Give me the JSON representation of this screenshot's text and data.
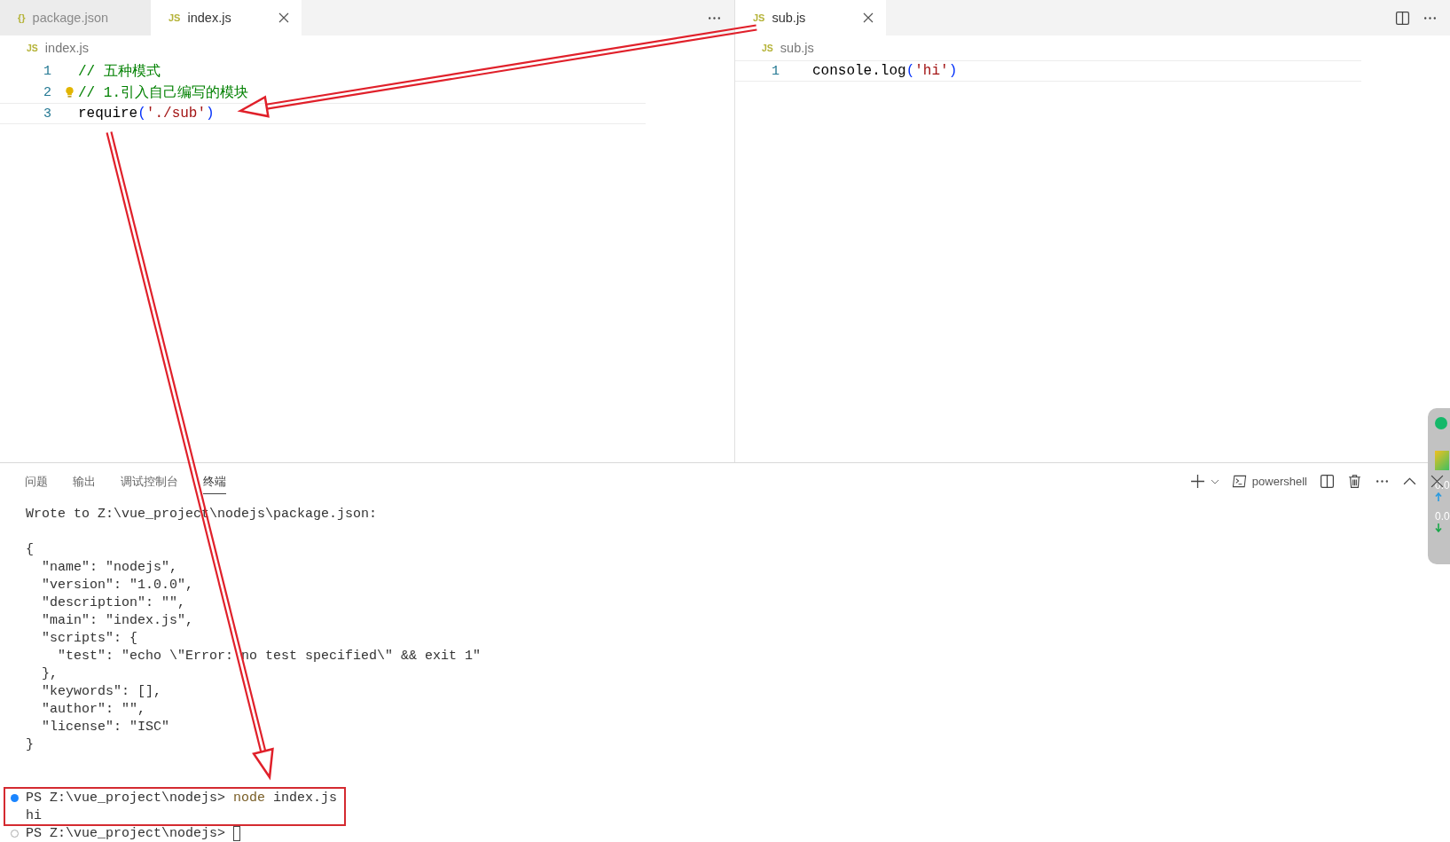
{
  "editor_groups": [
    {
      "tabs": [
        {
          "badge": "{}",
          "label": "package.json",
          "selected": false,
          "closable": false
        },
        {
          "badge": "JS",
          "label": "index.js",
          "selected": true,
          "closable": true
        }
      ],
      "breadcrumb": {
        "badge": "JS",
        "label": "index.js"
      },
      "lines": [
        {
          "number": "1",
          "current": false,
          "lightbulb": false,
          "tokens": [
            {
              "kind": "comment",
              "text": "// 五种模式"
            }
          ]
        },
        {
          "number": "2",
          "current": false,
          "lightbulb": true,
          "tokens": [
            {
              "kind": "comment",
              "text": "// 1.引入自己编写的模块"
            }
          ]
        },
        {
          "number": "3",
          "current": true,
          "lightbulb": false,
          "tokens": [
            {
              "kind": "plain",
              "text": "require"
            },
            {
              "kind": "bracket",
              "text": "("
            },
            {
              "kind": "string",
              "text": "'./sub'"
            },
            {
              "kind": "bracket",
              "text": ")"
            }
          ]
        }
      ]
    },
    {
      "tabs": [
        {
          "badge": "JS",
          "label": "sub.js",
          "selected": true,
          "closable": true
        }
      ],
      "breadcrumb": {
        "badge": "JS",
        "label": "sub.js"
      },
      "lines": [
        {
          "number": "1",
          "current": true,
          "lightbulb": false,
          "tokens": [
            {
              "kind": "plain",
              "text": "console.log"
            },
            {
              "kind": "bracket",
              "text": "("
            },
            {
              "kind": "string",
              "text": "'hi'"
            },
            {
              "kind": "bracket",
              "text": ")"
            }
          ]
        }
      ]
    }
  ],
  "panel": {
    "tabs": [
      {
        "label": "问题",
        "selected": false
      },
      {
        "label": "输出",
        "selected": false
      },
      {
        "label": "调试控制台",
        "selected": false
      },
      {
        "label": "终端",
        "selected": true
      }
    ],
    "terminal_name": "powershell",
    "lines": [
      {
        "kind": "text",
        "text": "Wrote to Z:\\vue_project\\nodejs\\package.json:"
      },
      {
        "kind": "blank"
      },
      {
        "kind": "text",
        "text": "{"
      },
      {
        "kind": "text",
        "text": "  \"name\": \"nodejs\","
      },
      {
        "kind": "text",
        "text": "  \"version\": \"1.0.0\","
      },
      {
        "kind": "text",
        "text": "  \"description\": \"\","
      },
      {
        "kind": "text",
        "text": "  \"main\": \"index.js\","
      },
      {
        "kind": "text",
        "text": "  \"scripts\": {"
      },
      {
        "kind": "text",
        "text": "    \"test\": \"echo \\\"Error: no test specified\\\" && exit 1\""
      },
      {
        "kind": "text",
        "text": "  },"
      },
      {
        "kind": "text",
        "text": "  \"keywords\": [],"
      },
      {
        "kind": "text",
        "text": "  \"author\": \"\","
      },
      {
        "kind": "text",
        "text": "  \"license\": \"ISC\""
      },
      {
        "kind": "text",
        "text": "}"
      },
      {
        "kind": "blank"
      },
      {
        "kind": "blank"
      },
      {
        "kind": "prompt",
        "succeeded": true,
        "prompt": "PS Z:\\vue_project\\nodejs>",
        "command": "node",
        "args": "index.js",
        "cursor": false
      },
      {
        "kind": "text",
        "text": "hi"
      },
      {
        "kind": "prompt",
        "succeeded": false,
        "prompt": "PS Z:\\vue_project\\nodejs>",
        "cursor": true
      }
    ]
  },
  "network_widget": {
    "upload": "0.0",
    "download": "0.0"
  }
}
